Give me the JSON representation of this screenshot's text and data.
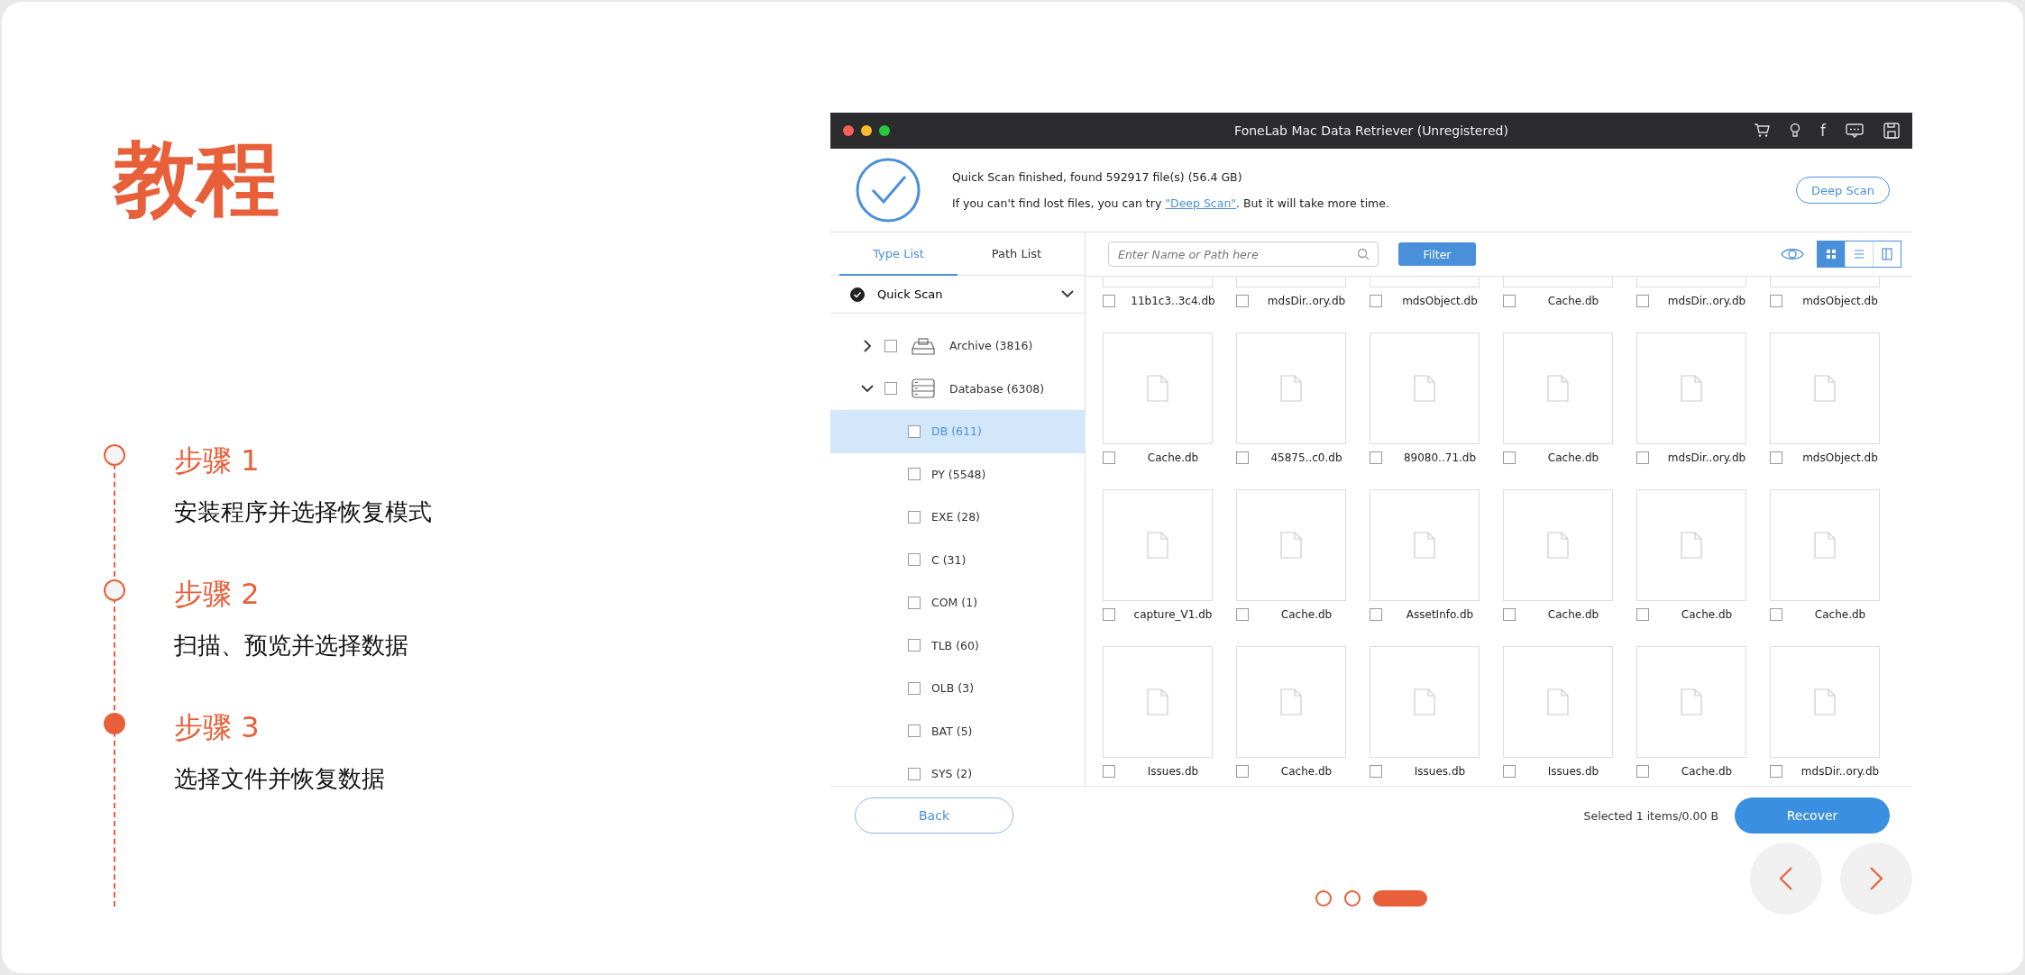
{
  "heading": "教程",
  "steps": [
    {
      "title": "步骤 1",
      "description": "安装程序并选择恢复模式",
      "selected": false
    },
    {
      "title": "步骤 2",
      "description": "扫描、预览并选择数据",
      "selected": false
    },
    {
      "title": "步骤 3",
      "description": "选择文件并恢复数据",
      "selected": true
    }
  ],
  "app": {
    "title": "FoneLab Mac Data Retriever (Unregistered)",
    "title_bar_glyph": "f",
    "scan_status": "Quick Scan finished, found 592917 file(s) (56.4 GB)",
    "hint": {
      "before": "If you can't find lost files, you can try ",
      "link": "\"Deep Scan\"",
      "after": ". But it will take more time."
    },
    "deep_scan_button": "Deep Scan",
    "tabs": [
      {
        "label": "Type List",
        "selected": true
      },
      {
        "label": "Path List",
        "selected": false
      }
    ],
    "scan_mode": {
      "label": "Quick Scan",
      "checked": true
    },
    "tree": [
      {
        "label": "Archive (3816)",
        "kind": "archive",
        "expanded": false,
        "checked": false,
        "selected": false
      },
      {
        "label": "Database (6308)",
        "kind": "database",
        "expanded": true,
        "checked": false,
        "selected": false,
        "children": [
          {
            "label": "DB (611)",
            "checked": false,
            "selected": true
          },
          {
            "label": "PY (5548)",
            "checked": false,
            "selected": false
          },
          {
            "label": "EXE (28)",
            "checked": false,
            "selected": false
          },
          {
            "label": "C (31)",
            "checked": false,
            "selected": false
          },
          {
            "label": "COM (1)",
            "checked": false,
            "selected": false
          },
          {
            "label": "TLB (60)",
            "checked": false,
            "selected": false
          },
          {
            "label": "OLB (3)",
            "checked": false,
            "selected": false
          },
          {
            "label": "BAT (5)",
            "checked": false,
            "selected": false
          },
          {
            "label": "SYS (2)",
            "checked": false,
            "selected": false
          }
        ]
      }
    ],
    "search": {
      "placeholder": "Enter Name or Path here"
    },
    "filter_button": "Filter",
    "view_modes": [
      {
        "kind": "grid",
        "selected": true
      },
      {
        "kind": "list",
        "selected": false
      },
      {
        "kind": "detail",
        "selected": false
      }
    ],
    "files": [
      {
        "name": "11b1c3..3c4.db",
        "checked": false
      },
      {
        "name": "mdsDir..ory.db",
        "checked": false
      },
      {
        "name": "mdsObject.db",
        "checked": false
      },
      {
        "name": "Cache.db",
        "checked": false
      },
      {
        "name": "mdsDir..ory.db",
        "checked": false
      },
      {
        "name": "mdsObject.db",
        "checked": false
      },
      {
        "name": "Cache.db",
        "checked": false
      },
      {
        "name": "45875..c0.db",
        "checked": false
      },
      {
        "name": "89080..71.db",
        "checked": false
      },
      {
        "name": "Cache.db",
        "checked": false
      },
      {
        "name": "mdsDir..ory.db",
        "checked": false
      },
      {
        "name": "mdsObject.db",
        "checked": false
      },
      {
        "name": "capture_V1.db",
        "checked": false
      },
      {
        "name": "Cache.db",
        "checked": false
      },
      {
        "name": "AssetInfo.db",
        "checked": false
      },
      {
        "name": "Cache.db",
        "checked": false
      },
      {
        "name": "Cache.db",
        "checked": false
      },
      {
        "name": "Cache.db",
        "checked": false
      },
      {
        "name": "Issues.db",
        "checked": false
      },
      {
        "name": "Cache.db",
        "checked": false
      },
      {
        "name": "Issues.db",
        "checked": false
      },
      {
        "name": "Issues.db",
        "checked": false
      },
      {
        "name": "Cache.db",
        "checked": false
      },
      {
        "name": "mdsDir..ory.db",
        "checked": false
      }
    ],
    "back_button": "Back",
    "selection_summary": "Selected 1 items/0.00  B",
    "recover_button": "Recover"
  },
  "pager": [
    {
      "selected": false
    },
    {
      "selected": false
    },
    {
      "selected": true
    }
  ]
}
